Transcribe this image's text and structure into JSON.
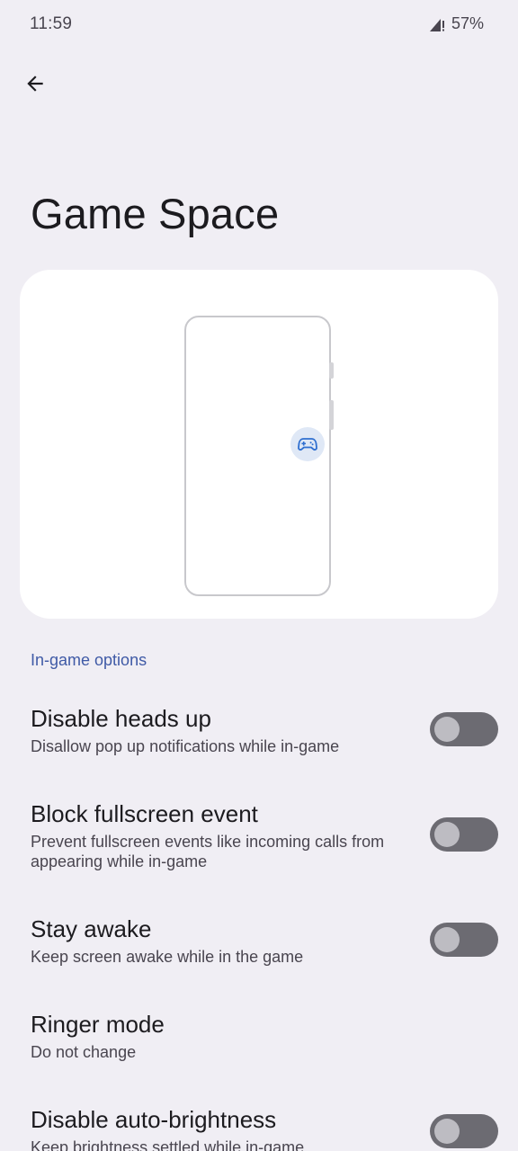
{
  "status_bar": {
    "time": "11:59",
    "battery": "57%",
    "signal_icon": "signal-alert-icon"
  },
  "toolbar": {
    "back_icon": "arrow-back-icon"
  },
  "page": {
    "title": "Game Space"
  },
  "preview": {
    "fab_icon": "gamepad-icon",
    "fab_color": "#2f6fd0"
  },
  "section": {
    "header": "In-game options"
  },
  "settings": [
    {
      "title": "Disable heads up",
      "summary": "Disallow pop up notifications while in-game",
      "has_switch": true,
      "checked": false
    },
    {
      "title": "Block fullscreen event",
      "summary": "Prevent fullscreen events like incoming calls from appearing while in-game",
      "has_switch": true,
      "checked": false
    },
    {
      "title": "Stay awake",
      "summary": "Keep screen awake while in the game",
      "has_switch": true,
      "checked": false
    },
    {
      "title": "Ringer mode",
      "summary": "Do not change",
      "has_switch": false
    },
    {
      "title": "Disable auto-brightness",
      "summary": "Keep brightness settled while in-game",
      "has_switch": true,
      "checked": false
    }
  ],
  "colors": {
    "background": "#f0eef4",
    "accent": "#3f5aa6",
    "switch_track_off": "#6c6b72",
    "switch_thumb_off": "#bdbcc2"
  }
}
